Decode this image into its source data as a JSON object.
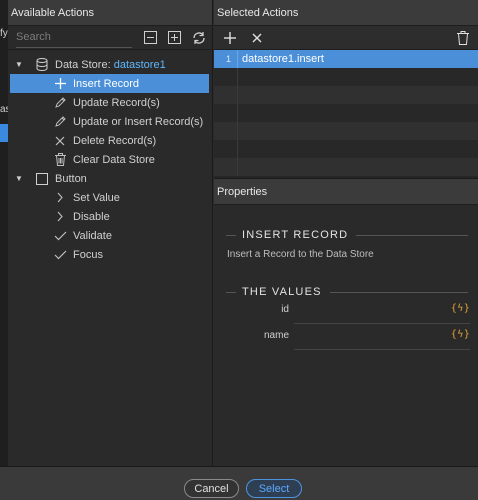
{
  "edge": {
    "fragment_top": "fy",
    "fragment_mid": "as"
  },
  "available_actions": {
    "title": "Available Actions",
    "search_placeholder": "Search",
    "tree": [
      {
        "type": "group",
        "label": "Data Store:",
        "value": "datastore1",
        "icon": "database-icon",
        "expanded": true,
        "children": [
          {
            "label": "Insert Record",
            "icon": "plus-icon",
            "selected": true
          },
          {
            "label": "Update Record(s)",
            "icon": "pencil-icon"
          },
          {
            "label": "Update or Insert Record(s)",
            "icon": "pencil-icon"
          },
          {
            "label": "Delete Record(s)",
            "icon": "x-icon"
          },
          {
            "label": "Clear Data Store",
            "icon": "trash-icon"
          }
        ]
      },
      {
        "type": "group",
        "label": "Button",
        "icon": "checkbox-icon",
        "expanded": true,
        "children": [
          {
            "label": "Set Value",
            "icon": "chevron-right-icon"
          },
          {
            "label": "Disable",
            "icon": "chevron-right-icon"
          },
          {
            "label": "Validate",
            "icon": "checkmark-icon"
          },
          {
            "label": "Focus",
            "icon": "checkmark-icon"
          }
        ]
      }
    ]
  },
  "selected_actions": {
    "title": "Selected Actions",
    "rows": [
      {
        "num": "1",
        "text": "datastore1.insert"
      }
    ]
  },
  "properties": {
    "title": "Properties",
    "section1": {
      "heading": "INSERT RECORD",
      "description": "Insert a Record to the Data Store"
    },
    "section2": {
      "heading": "THE VALUES",
      "fields": [
        {
          "label": "id",
          "bolt": "{ϟ}"
        },
        {
          "label": "name",
          "bolt": "{ϟ}"
        }
      ]
    }
  },
  "footer": {
    "cancel_label": "Cancel",
    "select_label": "Select"
  },
  "colors": {
    "accent": "#4a8fd8",
    "link": "#5fb8ff",
    "bolt": "#e0a23c"
  }
}
